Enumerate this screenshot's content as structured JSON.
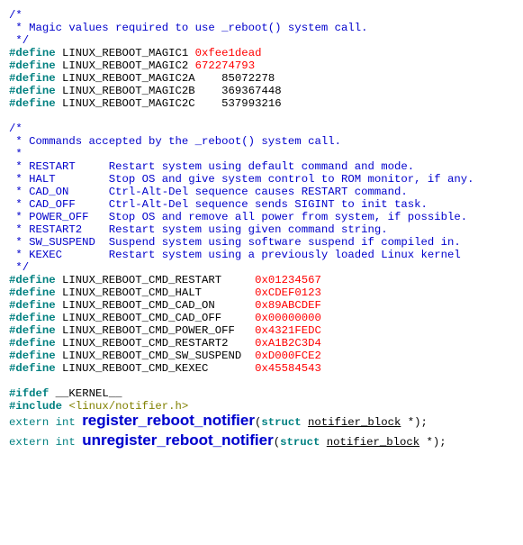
{
  "block1_header": "/*\n * Magic values required to use _reboot() system call.\n */",
  "defs1": [
    {
      "name": "LINUX_REBOOT_MAGIC1",
      "value": "0xfee1dead",
      "red": true,
      "pad": ""
    },
    {
      "name": "LINUX_REBOOT_MAGIC2",
      "value": "672274793",
      "red": true,
      "pad": ""
    },
    {
      "name": "LINUX_REBOOT_MAGIC2A",
      "value": "85072278",
      "red": false,
      "pad": "   "
    },
    {
      "name": "LINUX_REBOOT_MAGIC2B",
      "value": "369367448",
      "red": false,
      "pad": "   "
    },
    {
      "name": "LINUX_REBOOT_MAGIC2C",
      "value": "537993216",
      "red": false,
      "pad": "   "
    }
  ],
  "block2_header": "/*\n * Commands accepted by the _reboot() system call.\n *\n * RESTART     Restart system using default command and mode.\n * HALT        Stop OS and give system control to ROM monitor, if any.\n * CAD_ON      Ctrl-Alt-Del sequence causes RESTART command.\n * CAD_OFF     Ctrl-Alt-Del sequence sends SIGINT to init task.\n * POWER_OFF   Stop OS and remove all power from system, if possible.\n * RESTART2    Restart system using given command string.\n * SW_SUSPEND  Suspend system using software suspend if compiled in.\n * KEXEC       Restart system using a previously loaded Linux kernel\n */",
  "defs2": [
    {
      "name": "LINUX_REBOOT_CMD_RESTART",
      "value": "0x01234567",
      "pad": "    "
    },
    {
      "name": "LINUX_REBOOT_CMD_HALT",
      "value": "0xCDEF0123",
      "pad": "       "
    },
    {
      "name": "LINUX_REBOOT_CMD_CAD_ON",
      "value": "0x89ABCDEF",
      "pad": "     "
    },
    {
      "name": "LINUX_REBOOT_CMD_CAD_OFF",
      "value": "0x00000000",
      "pad": "    "
    },
    {
      "name": "LINUX_REBOOT_CMD_POWER_OFF",
      "value": "0x4321FEDC",
      "pad": "  "
    },
    {
      "name": "LINUX_REBOOT_CMD_RESTART2",
      "value": "0xA1B2C3D4",
      "pad": "   "
    },
    {
      "name": "LINUX_REBOOT_CMD_SW_SUSPEND",
      "value": "0xD000FCE2",
      "pad": " "
    },
    {
      "name": "LINUX_REBOOT_CMD_KEXEC",
      "value": "0x45584543",
      "pad": "      "
    }
  ],
  "ifdef": {
    "kw": "#ifdef",
    "sym": "__KERNEL__"
  },
  "include": {
    "kw": "#include",
    "hdr": "<linux/notifier.h>"
  },
  "decls": [
    {
      "prefix": "extern int ",
      "name": "register_reboot_notifier",
      "open": "(",
      "kw": "struct",
      "type": "notifier_block",
      "suffix": " *);"
    },
    {
      "prefix": "extern int ",
      "name": "unregister_reboot_notifier",
      "open": "(",
      "kw": "struct",
      "type": "notifier_block",
      "suffix": " *);"
    }
  ],
  "keywords": {
    "define": "#define"
  }
}
